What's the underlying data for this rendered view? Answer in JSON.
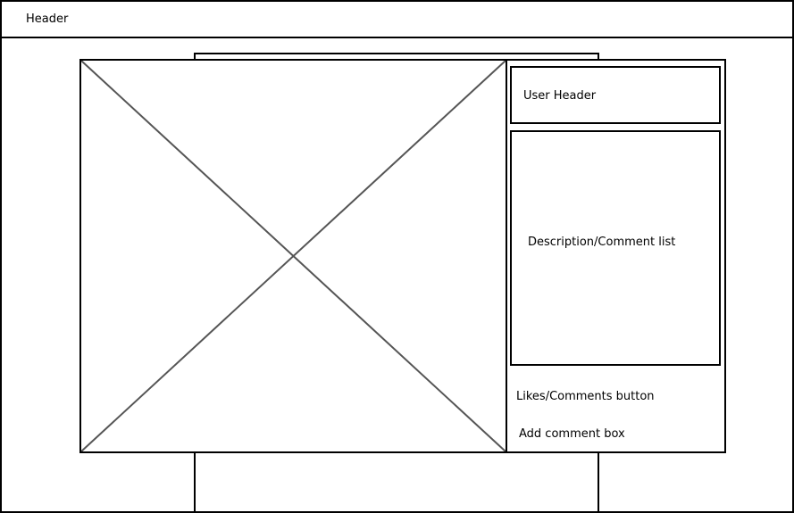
{
  "header": {
    "label": "Header"
  },
  "image_placeholder": {
    "icon": "image-placeholder-x"
  },
  "side_panel": {
    "user_header": "User Header",
    "description_list": "Description/Comment list",
    "likes_comments_button": "Likes/Comments button",
    "add_comment_box": "Add comment box"
  }
}
